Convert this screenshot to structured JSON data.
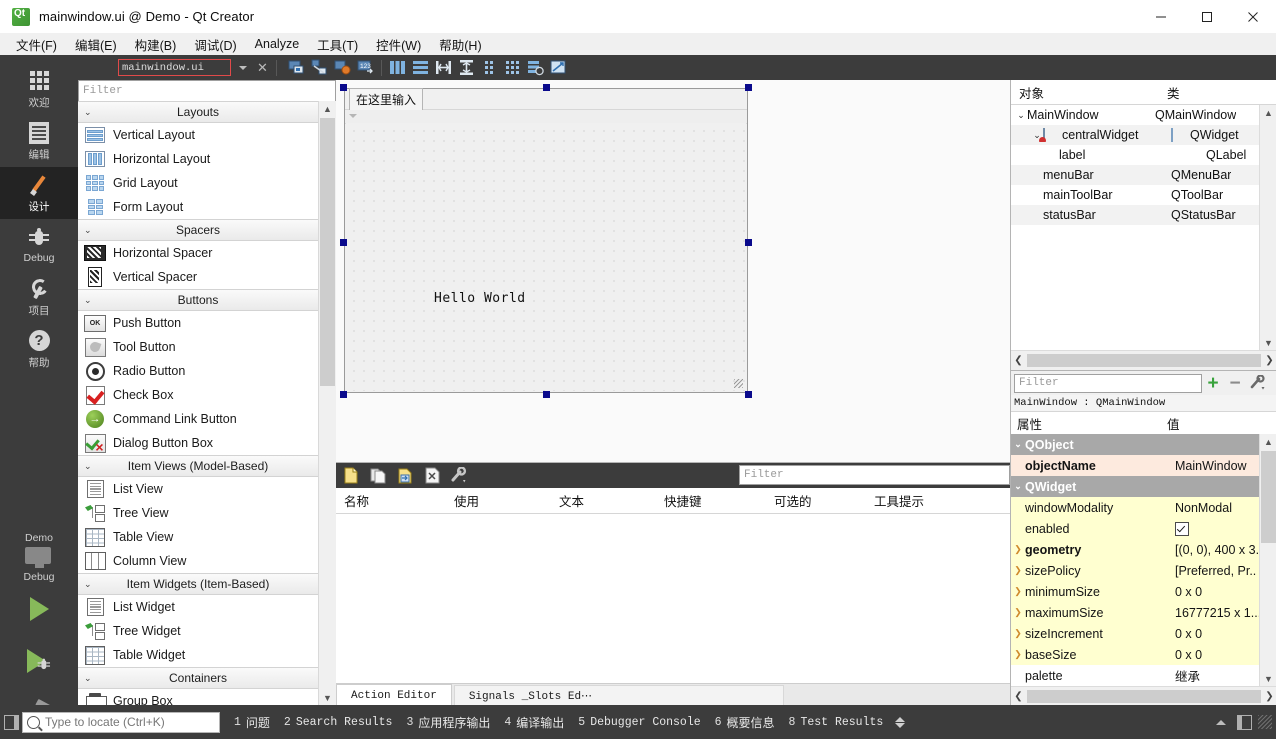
{
  "window": {
    "title": "mainwindow.ui @ Demo - Qt Creator",
    "app_icon": "qt-logo-icon",
    "minimize": "—",
    "maximize": "☐",
    "close": "✕"
  },
  "menubar": {
    "items": [
      {
        "label": "文件(F)",
        "name": "menu-file"
      },
      {
        "label": "编辑(E)",
        "name": "menu-edit"
      },
      {
        "label": "构建(B)",
        "name": "menu-build"
      },
      {
        "label": "调试(D)",
        "name": "menu-debug"
      },
      {
        "label": "Analyze",
        "name": "menu-analyze"
      },
      {
        "label": "工具(T)",
        "name": "menu-tools"
      },
      {
        "label": "控件(W)",
        "name": "menu-widgets"
      },
      {
        "label": "帮助(H)",
        "name": "menu-help"
      }
    ]
  },
  "modebar": {
    "modes": [
      {
        "label": "欢迎",
        "icon": "grid-icon",
        "active": false
      },
      {
        "label": "编辑",
        "icon": "document-icon",
        "active": false
      },
      {
        "label": "设计",
        "icon": "pencil-icon",
        "active": true
      },
      {
        "label": "Debug",
        "icon": "bug-icon",
        "active": false
      },
      {
        "label": "项目",
        "icon": "wrench-icon",
        "active": false
      },
      {
        "label": "帮助",
        "icon": "question-mark-icon",
        "active": false
      }
    ],
    "kit": {
      "project_name": "Demo",
      "build_config": "Debug",
      "icon": "monitor-icon"
    },
    "run_button": "run-icon",
    "debug_button": "debug-run-icon",
    "build_button": "hammer-icon"
  },
  "editor_toolbar": {
    "open_file": "mainwindow.ui",
    "dropdown_icon": "chevron-down-icon",
    "close_icon": "close-icon",
    "tools": [
      {
        "name": "edit-widgets-icon"
      },
      {
        "name": "edit-signals-slots-icon"
      },
      {
        "name": "edit-buddies-icon"
      },
      {
        "name": "edit-tab-order-icon"
      },
      {
        "name": "layout-horizontally-icon"
      },
      {
        "name": "layout-vertically-icon"
      },
      {
        "name": "layout-splitter-horizontal-icon"
      },
      {
        "name": "layout-splitter-vertical-icon"
      },
      {
        "name": "layout-form-icon"
      },
      {
        "name": "layout-grid-icon"
      },
      {
        "name": "break-layout-icon"
      },
      {
        "name": "adjust-size-icon"
      }
    ]
  },
  "widget_box": {
    "filter_placeholder": "Filter",
    "groups": [
      {
        "title": "Layouts",
        "name": "widget-group-layouts",
        "items": [
          {
            "label": "Vertical Layout",
            "icon": "vertical-layout-icon"
          },
          {
            "label": "Horizontal Layout",
            "icon": "horizontal-layout-icon"
          },
          {
            "label": "Grid Layout",
            "icon": "grid-layout-icon"
          },
          {
            "label": "Form Layout",
            "icon": "form-layout-icon"
          }
        ]
      },
      {
        "title": "Spacers",
        "name": "widget-group-spacers",
        "items": [
          {
            "label": "Horizontal Spacer",
            "icon": "horizontal-spacer-icon"
          },
          {
            "label": "Vertical Spacer",
            "icon": "vertical-spacer-icon"
          }
        ]
      },
      {
        "title": "Buttons",
        "name": "widget-group-buttons",
        "items": [
          {
            "label": "Push Button",
            "icon": "push-button-icon"
          },
          {
            "label": "Tool Button",
            "icon": "tool-button-icon"
          },
          {
            "label": "Radio Button",
            "icon": "radio-button-icon"
          },
          {
            "label": "Check Box",
            "icon": "check-box-icon"
          },
          {
            "label": "Command Link Button",
            "icon": "command-link-button-icon"
          },
          {
            "label": "Dialog Button Box",
            "icon": "dialog-button-box-icon"
          }
        ]
      },
      {
        "title": "Item Views (Model-Based)",
        "name": "widget-group-item-views",
        "items": [
          {
            "label": "List View",
            "icon": "list-view-icon"
          },
          {
            "label": "Tree View",
            "icon": "tree-view-icon"
          },
          {
            "label": "Table View",
            "icon": "table-view-icon"
          },
          {
            "label": "Column View",
            "icon": "column-view-icon"
          }
        ]
      },
      {
        "title": "Item Widgets (Item-Based)",
        "name": "widget-group-item-widgets",
        "items": [
          {
            "label": "List Widget",
            "icon": "list-widget-icon"
          },
          {
            "label": "Tree Widget",
            "icon": "tree-widget-icon"
          },
          {
            "label": "Table Widget",
            "icon": "table-widget-icon"
          }
        ]
      },
      {
        "title": "Containers",
        "name": "widget-group-containers",
        "items": [
          {
            "label": "Group Box",
            "icon": "group-box-icon"
          }
        ]
      }
    ]
  },
  "canvas": {
    "menu_placeholder": "在这里输入",
    "label_text": "Hello World",
    "selected": true
  },
  "action_editor": {
    "filter_placeholder": "Filter",
    "toolbar": [
      {
        "name": "new-action-icon"
      },
      {
        "name": "copy-action-icon"
      },
      {
        "name": "paste-action-icon"
      },
      {
        "name": "delete-action-icon"
      },
      {
        "name": "configure-icon"
      }
    ],
    "columns": [
      "名称",
      "使用",
      "文本",
      "快捷键",
      "可选的",
      "工具提示"
    ],
    "rows": [],
    "tabs": [
      {
        "label": "Action Editor",
        "active": true
      },
      {
        "label": "Signals _Slots Ed⋯",
        "active": false
      }
    ]
  },
  "object_tree": {
    "columns": [
      "对象",
      "类"
    ],
    "rows": [
      {
        "name": "MainWindow",
        "class": "QMainWindow",
        "depth": 0,
        "chevron": "⌄",
        "icon": "",
        "class_icon": ""
      },
      {
        "name": "centralWidget",
        "class": "QWidget",
        "depth": 1,
        "chevron": "⌄",
        "icon": "central-widget-icon",
        "class_icon": "qwidget-icon"
      },
      {
        "name": "label",
        "class": "QLabel",
        "depth": 2,
        "chevron": "",
        "icon": "",
        "class_icon": "qlabel-icon"
      },
      {
        "name": "menuBar",
        "class": "QMenuBar",
        "depth": 1,
        "chevron": "",
        "icon": "",
        "class_icon": ""
      },
      {
        "name": "mainToolBar",
        "class": "QToolBar",
        "depth": 1,
        "chevron": "",
        "icon": "",
        "class_icon": ""
      },
      {
        "name": "statusBar",
        "class": "QStatusBar",
        "depth": 1,
        "chevron": "",
        "icon": "",
        "class_icon": ""
      }
    ]
  },
  "property_editor": {
    "filter_placeholder": "Filter",
    "add_icon": "plus-icon",
    "remove_icon": "minus-icon",
    "configure_icon": "wrench-icon",
    "subject": "MainWindow : QMainWindow",
    "columns": [
      "属性",
      "值"
    ],
    "rows": [
      {
        "key": "QObject",
        "value": "",
        "type": "group"
      },
      {
        "key": "objectName",
        "value": "MainWindow",
        "type": "name"
      },
      {
        "key": "QWidget",
        "value": "",
        "type": "group"
      },
      {
        "key": "windowModality",
        "value": "NonModal",
        "type": "yellow"
      },
      {
        "key": "enabled",
        "value": "checked",
        "type": "yellow-check"
      },
      {
        "key": "geometry",
        "value": "[(0, 0), 400 x 3..",
        "type": "yellow",
        "expandable": true,
        "bold": true
      },
      {
        "key": "sizePolicy",
        "value": "[Preferred, Pr..",
        "type": "yellow",
        "expandable": true
      },
      {
        "key": "minimumSize",
        "value": "0 x 0",
        "type": "yellow",
        "expandable": true
      },
      {
        "key": "maximumSize",
        "value": "16777215 x 1...",
        "type": "yellow",
        "expandable": true
      },
      {
        "key": "sizeIncrement",
        "value": "0 x 0",
        "type": "yellow",
        "expandable": true
      },
      {
        "key": "baseSize",
        "value": "0 x 0",
        "type": "yellow",
        "expandable": true
      },
      {
        "key": "palette",
        "value": "继承",
        "type": "white"
      }
    ]
  },
  "statusbar": {
    "locate_placeholder": "Type to locate (Ctrl+K)",
    "search_icon": "search-icon",
    "panels": [
      {
        "num": "1",
        "label": "问题",
        "mono": false
      },
      {
        "num": "2",
        "label": "Search Results",
        "mono": true
      },
      {
        "num": "3",
        "label": "应用程序输出",
        "mono": false
      },
      {
        "num": "4",
        "label": "编译输出",
        "mono": false
      },
      {
        "num": "5",
        "label": "Debugger Console",
        "mono": true
      },
      {
        "num": "6",
        "label": "概要信息",
        "mono": false
      },
      {
        "num": "8",
        "label": "Test Results",
        "mono": true
      }
    ]
  },
  "colors": {
    "dark_chrome": "#3c3c3c",
    "mode_active": "#232323",
    "accent_orange": "#e8873a",
    "accent_green": "#87b95a",
    "selection_blue": "#0a0a8c",
    "property_yellow": "#ffffd0",
    "property_name_bg": "#fdeade",
    "group_gray": "#a8a8a8",
    "red_outline": "#e04a4a"
  }
}
